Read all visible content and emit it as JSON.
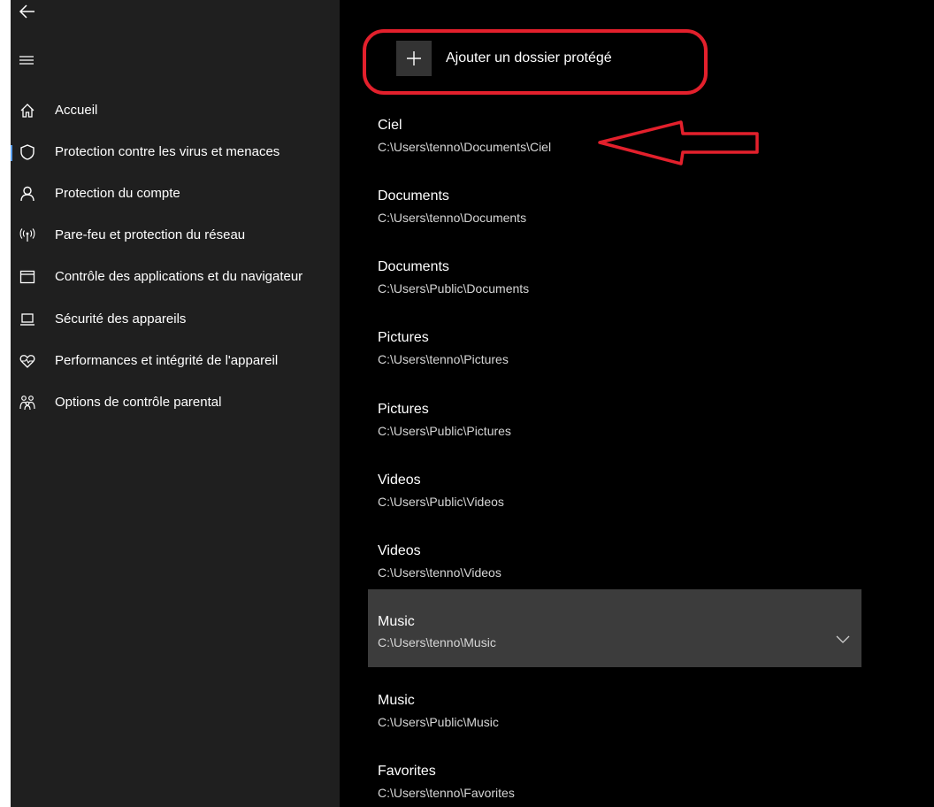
{
  "sidebar": {
    "items": [
      {
        "label": "Accueil",
        "icon": "home-icon"
      },
      {
        "label": "Protection contre les virus et menaces",
        "icon": "shield-icon"
      },
      {
        "label": "Protection du compte",
        "icon": "person-icon"
      },
      {
        "label": "Pare-feu et protection du réseau",
        "icon": "antenna-icon"
      },
      {
        "label": "Contrôle des applications et du navigateur",
        "icon": "browser-window-icon"
      },
      {
        "label": "Sécurité des appareils",
        "icon": "laptop-icon"
      },
      {
        "label": "Performances et intégrité de l'appareil",
        "icon": "heart-pulse-icon"
      },
      {
        "label": "Options de contrôle parental",
        "icon": "family-icon"
      }
    ]
  },
  "main": {
    "add_folder_label": "Ajouter un dossier protégé",
    "folders": [
      {
        "name": "Ciel",
        "path": "C:\\Users\\tenno\\Documents\\Ciel"
      },
      {
        "name": "Documents",
        "path": "C:\\Users\\tenno\\Documents"
      },
      {
        "name": "Documents",
        "path": "C:\\Users\\Public\\Documents"
      },
      {
        "name": "Pictures",
        "path": "C:\\Users\\tenno\\Pictures"
      },
      {
        "name": "Pictures",
        "path": "C:\\Users\\Public\\Pictures"
      },
      {
        "name": "Videos",
        "path": "C:\\Users\\Public\\Videos"
      },
      {
        "name": "Videos",
        "path": "C:\\Users\\tenno\\Videos"
      },
      {
        "name": "Music",
        "path": "C:\\Users\\tenno\\Music"
      },
      {
        "name": "Music",
        "path": "C:\\Users\\Public\\Music"
      },
      {
        "name": "Favorites",
        "path": "C:\\Users\\tenno\\Favorites"
      }
    ]
  },
  "colors": {
    "sidebar_bg": "#1f1f1f",
    "main_bg": "#000000",
    "selected_row_bg": "#3c3c3c",
    "annotation_red": "#e3202c",
    "active_indicator": "#5aa0f0"
  }
}
